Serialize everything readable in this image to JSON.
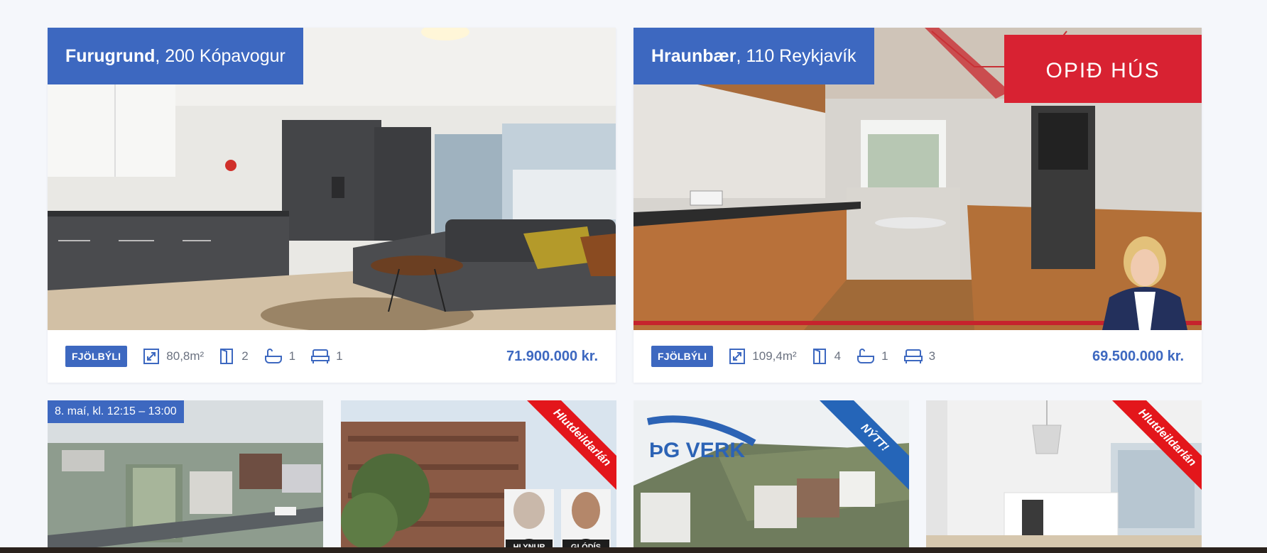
{
  "listings": [
    {
      "street": "Furugrund",
      "locality": ", 200 Kópavogur",
      "type_badge": "FJÖLBÝLI",
      "area": "80,8m²",
      "rooms": "2",
      "bathrooms": "1",
      "bedrooms": "1",
      "price": "71.900.000 kr."
    },
    {
      "street": "Hraunbær",
      "locality": ", 110 Reykjavík",
      "type_badge": "FJÖLBÝLI",
      "area": "109,4m²",
      "rooms": "4",
      "bathrooms": "1",
      "bedrooms": "3",
      "price": "69.500.000 kr.",
      "overlay_text": "OPIÐ HÚS"
    }
  ],
  "small_cards": [
    {
      "date_tag": "8. maí, kl. 12:15 – 13:00"
    },
    {
      "ribbon": "Hlutdeildarlán",
      "agent_names": [
        "HLYNUR",
        "GLÓDÍS"
      ]
    },
    {
      "ribbon": "NÝTT!",
      "logo_text": "ÞG VERK"
    },
    {
      "ribbon": "Hlutdeildarlán"
    }
  ],
  "colors": {
    "accent": "#3d68c0",
    "ribbon_red": "#e3161b",
    "ribbon_blue": "#2565b8",
    "page_bg": "#f5f7fb"
  },
  "icons": [
    "area-icon",
    "door-icon",
    "bathtub-icon",
    "bed-icon"
  ]
}
